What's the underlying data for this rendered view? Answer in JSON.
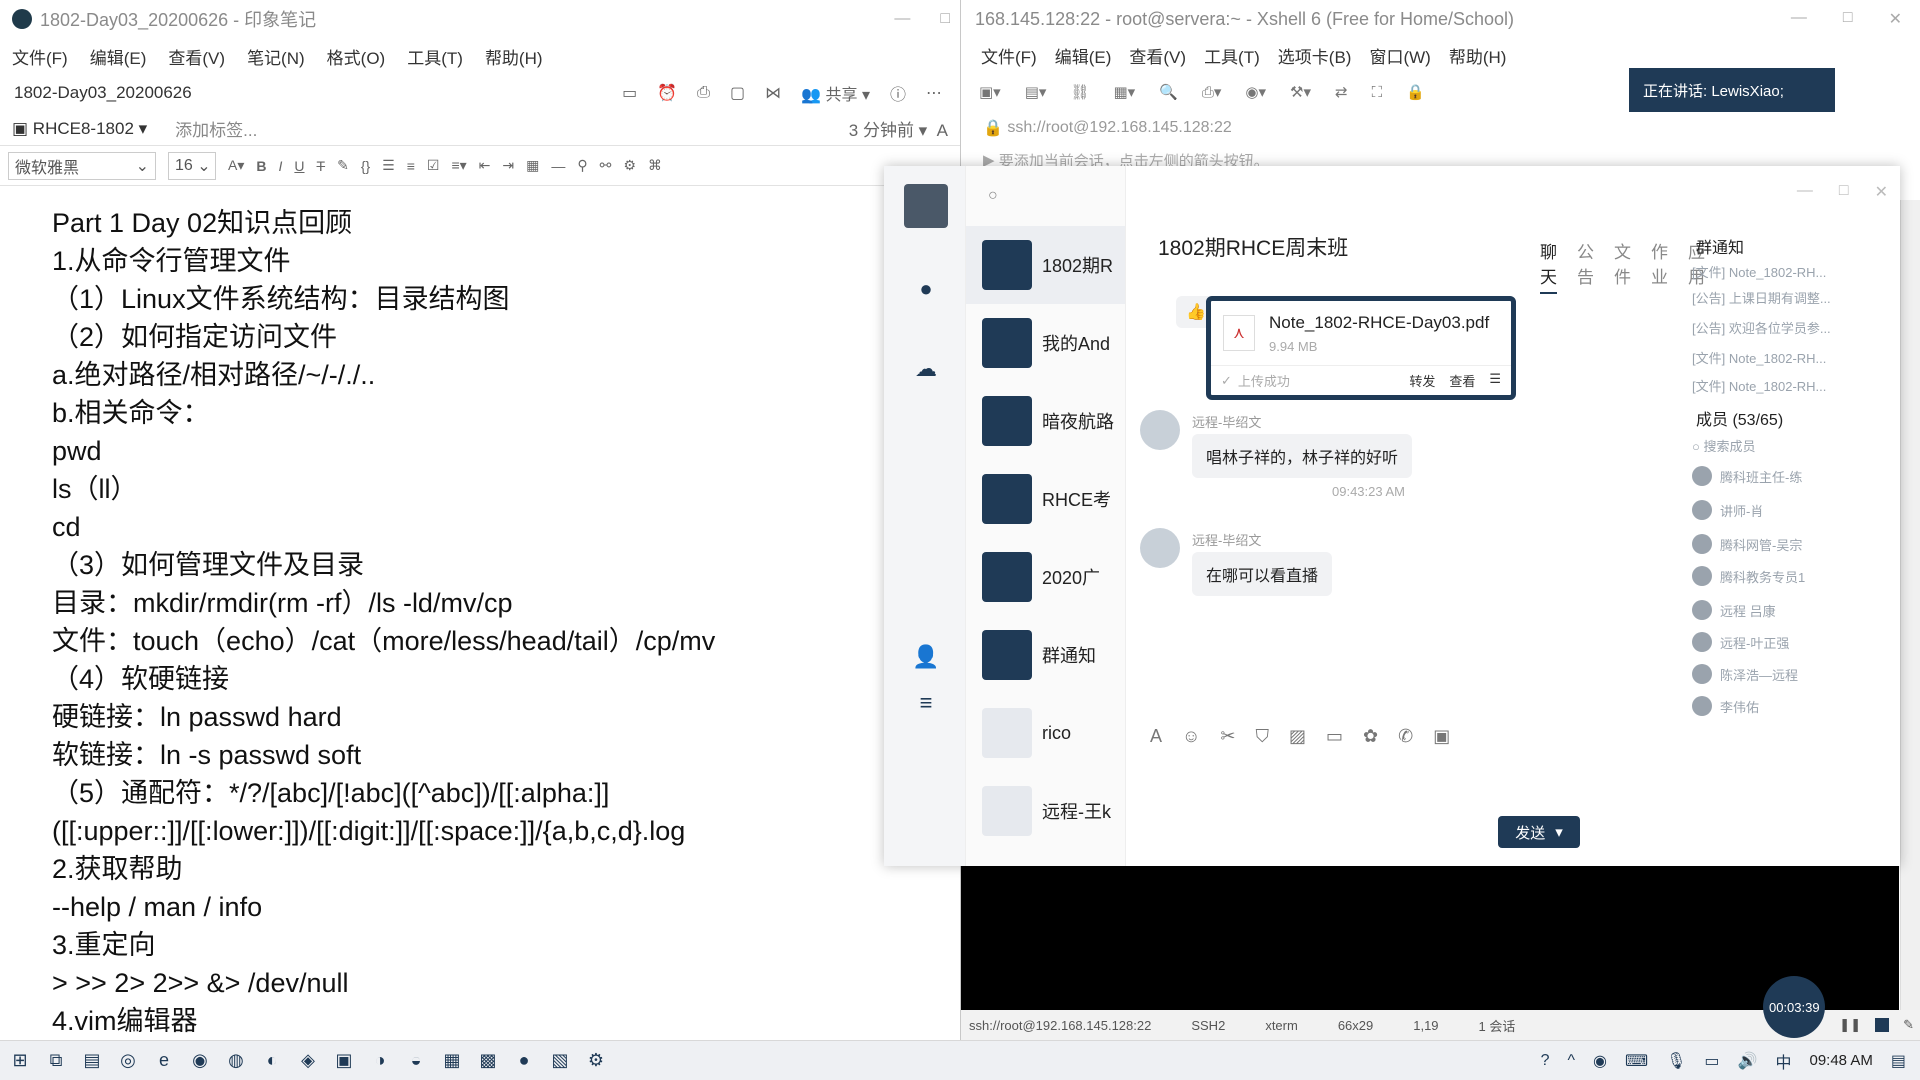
{
  "evernote": {
    "title": "1802-Day03_20200626 - 印象笔记",
    "menu": [
      "文件(F)",
      "编辑(E)",
      "查看(V)",
      "笔记(N)",
      "格式(O)",
      "工具(T)",
      "帮助(H)"
    ],
    "note_title": "1802-Day03_20200626",
    "share_label": "共享",
    "notebook": "RHCE8-1802",
    "add_tag": "添加标签...",
    "modified": "3 分钟前",
    "font_name": "微软雅黑",
    "font_size": "16",
    "content": [
      "Part 1 Day 02知识点回顾",
      "1.从命令行管理文件",
      "（1）Linux文件系统结构：目录结构图",
      "（2）如何指定访问文件",
      "a.绝对路径/相对路径/~/-/./..",
      "b.相关命令：",
      "pwd",
      "ls（ll）",
      "cd",
      "（3）如何管理文件及目录",
      "目录：mkdir/rmdir(rm -rf）/ls -ld/mv/cp",
      "文件：touch（echo）/cat（more/less/head/tail）/cp/mv",
      "（4）软硬链接",
      "硬链接：ln passwd hard",
      "软链接：ln -s passwd soft",
      "（5）通配符：*/?/[abc]/[!abc]([^abc])/[[:alpha:]]",
      "([[:upper::]]/[[:lower:]])/[[:digit:]]/[[:space:]]/{a,b,c,d}.log",
      "2.获取帮助",
      "--help / man / info",
      "3.重定向",
      "> >>  2> 2>> &> /dev/null",
      "4.vim编辑器"
    ]
  },
  "xshell": {
    "title": "168.145.128:22 - root@servera:~ - Xshell 6 (Free for Home/School)",
    "menu": [
      "文件(F)",
      "编辑(E)",
      "查看(V)",
      "工具(T)",
      "选项卡(B)",
      "窗口(W)",
      "帮助(H)"
    ],
    "speaking": "正在讲话: LewisXiao;",
    "address": "ssh://root@192.168.145.128:22",
    "hint": "要添加当前会话，点击左侧的箭头按钮。",
    "status": {
      "conn": "ssh://root@192.168.145.128:22",
      "proto": "SSH2",
      "term": "xterm",
      "size": "66x29",
      "pos": "1,19",
      "sessions": "1 会话"
    },
    "timer": "00:03:39"
  },
  "qq": {
    "contacts": [
      "1802期R",
      "我的And",
      "暗夜航路",
      "RHCE考",
      "2020广",
      "群通知",
      "rico",
      "远程-王k"
    ],
    "chat_title": "1802期RHCE周末班",
    "tabs": [
      "聊天",
      "公告",
      "文件",
      "作业",
      "应用"
    ],
    "file": {
      "name": "Note_1802-RHCE-Day03.pdf",
      "size": "9.94 MB",
      "status": "上传成功",
      "forward": "转发",
      "view": "查看"
    },
    "messages": [
      {
        "sender": "远程-毕绍文",
        "text": "唱林子祥的，林子祥的好听"
      },
      {
        "sender": "远程-毕绍文",
        "text": "在哪可以看直播"
      }
    ],
    "timestamp": "09:43:23 AM",
    "send_label": "发送",
    "right_panel": {
      "notice_title": "群通知",
      "notices": [
        "[文件] Note_1802-RH...",
        "[公告] 上课日期有调整...",
        "[公告] 欢迎各位学员参...",
        "[文件] Note_1802-RH...",
        "[文件] Note_1802-RH..."
      ],
      "members_title": "成员 (53/65)",
      "search_members": "搜索成员",
      "members": [
        "腾科班主任-练",
        "讲师-肖",
        "腾科网管-吴宗",
        "腾科教务专员1",
        "远程 吕康",
        "远程-叶正强",
        "陈泽浩—远程",
        "李伟佑"
      ]
    }
  },
  "taskbar": {
    "clock": "09:48 AM"
  }
}
